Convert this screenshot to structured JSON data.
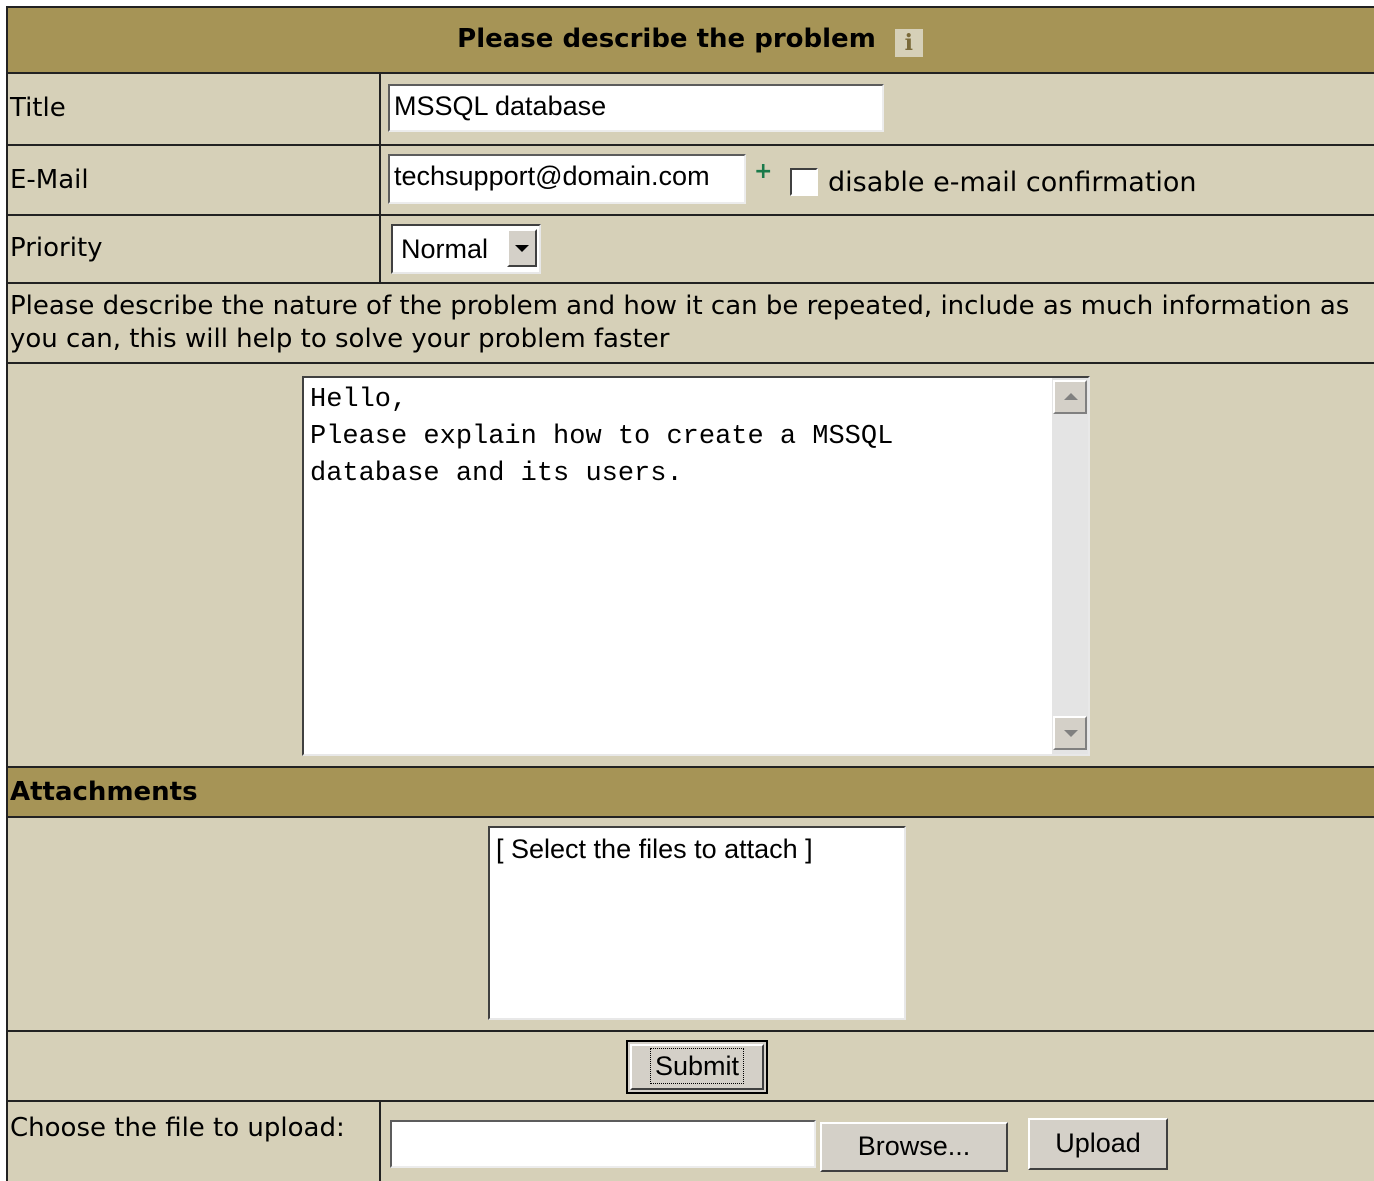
{
  "header": {
    "title": "Please describe the problem",
    "info_icon": "i"
  },
  "form": {
    "title_label": "Title",
    "title_value": "MSSQL database",
    "email_label": "E-Mail",
    "email_value": "techsupport@domain.com",
    "email_required_marker": "+",
    "disable_confirmation_label": "disable e-mail confirmation",
    "disable_confirmation_checked": false,
    "priority_label": "Priority",
    "priority_value": "Normal",
    "description_instructions": "Please describe the nature of the problem and how it can be repeated, include as much information as you can, this will help to solve your problem faster",
    "description_value": "Hello,\nPlease explain how to create a MSSQL\ndatabase and its users."
  },
  "attachments": {
    "header": "Attachments",
    "list_placeholder": "[ Select the files to attach ]",
    "submit_label": "Submit",
    "upload_label": "Choose the file to upload:",
    "file_value": "",
    "browse_label": "Browse...",
    "upload_button_label": "Upload"
  },
  "colors": {
    "header_bg": "#a69456",
    "body_bg": "#d6d0b8",
    "required_marker": "#1a7a4a"
  }
}
